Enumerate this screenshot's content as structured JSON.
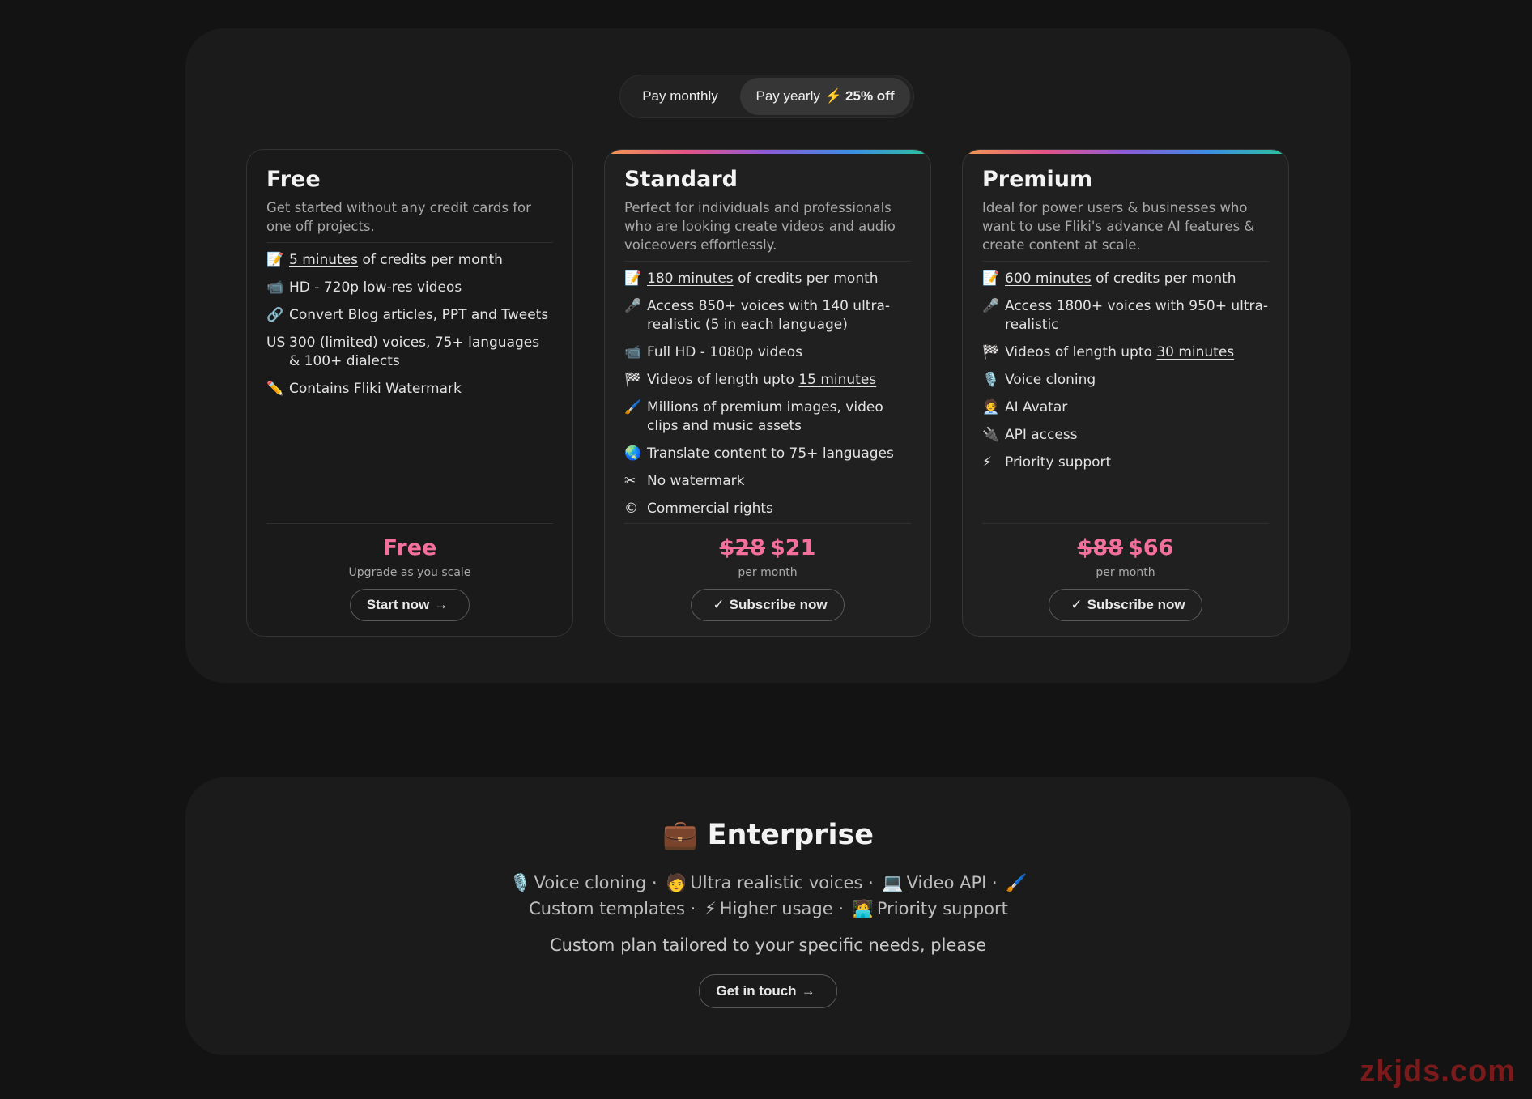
{
  "billing_toggle": {
    "monthly_label": "Pay monthly",
    "yearly_label": "Pay yearly",
    "yearly_discount": "25% off",
    "selected": "yearly"
  },
  "plans": [
    {
      "name": "Free",
      "description": "Get started without any credit cards for one off projects.",
      "features": [
        {
          "icon": "📝",
          "link": "5 minutes",
          "text": " of credits per month"
        },
        {
          "icon": "📹",
          "link": "",
          "text": "HD - 720p low-res videos"
        },
        {
          "icon": "🔗",
          "link": "",
          "text": "Convert Blog articles, PPT and Tweets"
        },
        {
          "icon": "US",
          "link": "",
          "text": "300 (limited) voices, 75+ languages & 100+ dialects"
        },
        {
          "icon": "✏️",
          "link": "",
          "text": "Contains Fliki Watermark"
        }
      ],
      "price_old": "",
      "price": "Free",
      "price_sub": "Upgrade as you scale",
      "button_label": "Start now"
    },
    {
      "name": "Standard",
      "description": "Perfect for individuals and professionals who are looking create videos and audio voiceovers effortlessly.",
      "features": [
        {
          "icon": "📝",
          "link": "180 minutes",
          "text": " of credits per month"
        },
        {
          "icon": "🎤",
          "prefix": "Access ",
          "link": "850+ voices",
          "text": " with 140 ultra-realistic (5 in each language)"
        },
        {
          "icon": "📹",
          "link": "",
          "text": "Full HD - 1080p videos"
        },
        {
          "icon": "🏁",
          "prefix": "Videos of length upto ",
          "link": "15 minutes",
          "text": ""
        },
        {
          "icon": "🖌️",
          "link": "",
          "text": "Millions of premium images, video clips and music assets"
        },
        {
          "icon": "🌏",
          "link": "",
          "text": "Translate content to 75+ languages"
        },
        {
          "icon": "✂",
          "link": "",
          "text": "No watermark"
        },
        {
          "icon": "©",
          "link": "",
          "text": "Commercial rights"
        }
      ],
      "price_old": "$28",
      "price": "$21",
      "price_sub": "per month",
      "button_label": "Subscribe now"
    },
    {
      "name": "Premium",
      "description": "Ideal for power users & businesses who want to use Fliki's advance AI features & create content at scale.",
      "features": [
        {
          "icon": "📝",
          "link": "600 minutes",
          "text": " of credits per month"
        },
        {
          "icon": "🎤",
          "prefix": "Access ",
          "link": "1800+ voices",
          "text": " with 950+ ultra-realistic"
        },
        {
          "icon": "🏁",
          "prefix": "Videos of length upto ",
          "link": "30 minutes",
          "text": ""
        },
        {
          "icon": "🎙️",
          "link": "",
          "text": "Voice cloning"
        },
        {
          "icon": "🧑‍💼",
          "link": "",
          "text": "AI Avatar"
        },
        {
          "icon": "🔌",
          "link": "",
          "text": "API access"
        },
        {
          "icon": "⚡",
          "link": "",
          "text": "Priority support"
        }
      ],
      "price_old": "$88",
      "price": "$66",
      "price_sub": "per month",
      "button_label": "Subscribe now"
    }
  ],
  "enterprise": {
    "icon": "💼",
    "title": "Enterprise",
    "features": [
      {
        "icon": "🎙️",
        "text": "Voice cloning"
      },
      {
        "icon": "🧑",
        "text": "Ultra realistic voices"
      },
      {
        "icon": "💻",
        "text": "Video API"
      },
      {
        "icon": "🖌️",
        "text": "Custom templates"
      },
      {
        "icon": "⚡",
        "text": "Higher usage"
      },
      {
        "icon": "🧑‍💻",
        "text": "Priority support"
      }
    ],
    "note": "Custom plan tailored to your specific needs, please",
    "button_label": "Get in touch"
  },
  "watermark": "zkjds.com"
}
